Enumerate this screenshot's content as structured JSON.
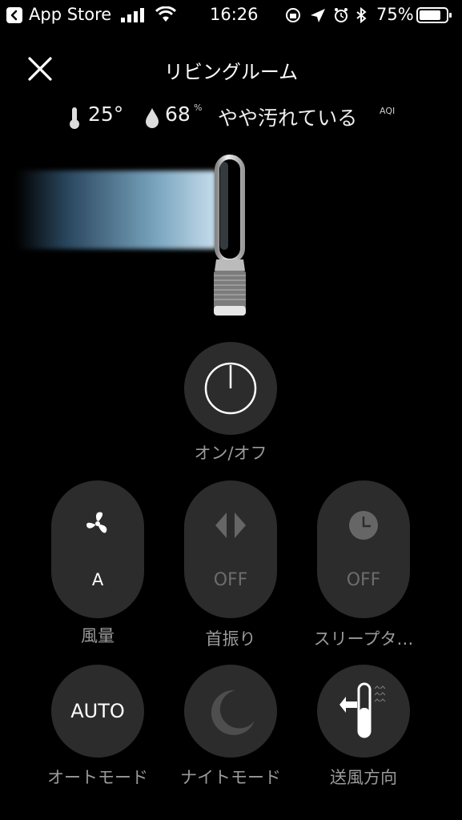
{
  "status_bar": {
    "back_app": "App Store",
    "time": "16:26",
    "battery": "75%"
  },
  "header": {
    "title": "リビングルーム",
    "close_icon": "close-icon"
  },
  "environment": {
    "temperature": "25°",
    "humidity": "68",
    "humidity_unit": "%",
    "air_quality": "やや汚れている",
    "aqi_label": "AQI"
  },
  "power": {
    "label": "オン/オフ",
    "icon": "power-icon"
  },
  "controls": [
    {
      "id": "fan-speed",
      "icon": "fan-icon",
      "value": "A",
      "label": "風量"
    },
    {
      "id": "oscillation",
      "icon": "oscillation-icon",
      "value": "OFF",
      "label": "首振り"
    },
    {
      "id": "sleep-timer",
      "icon": "clock-icon",
      "value": "OFF",
      "label": "スリープタ…"
    }
  ],
  "modes": [
    {
      "id": "auto-mode",
      "text": "AUTO",
      "label": "オートモード"
    },
    {
      "id": "night-mode",
      "icon": "moon-icon",
      "label": "ナイトモード"
    },
    {
      "id": "airflow-direction",
      "icon": "airflow-direction-icon",
      "label": "送風方向"
    }
  ],
  "colors": {
    "background": "#000000",
    "button": "#2c2c2c",
    "label": "#9a9a9a",
    "airflow": "#cfe6f5"
  }
}
